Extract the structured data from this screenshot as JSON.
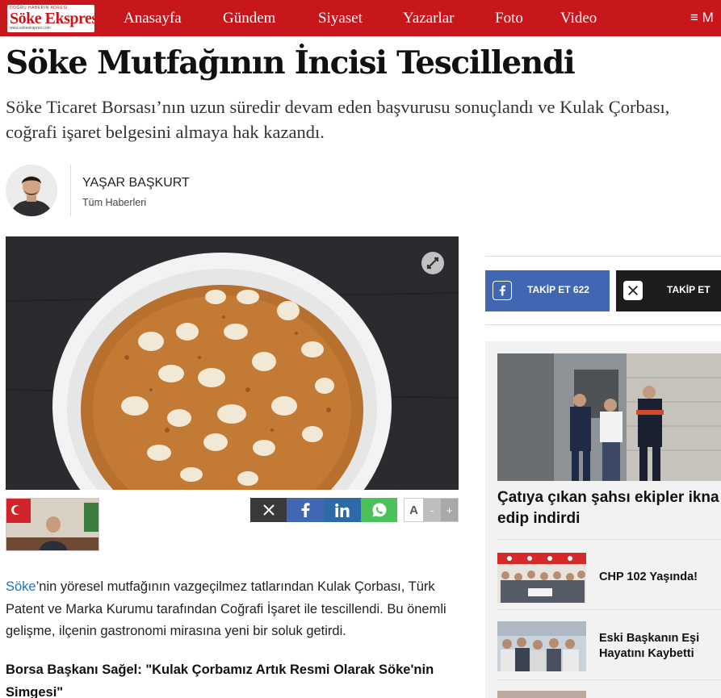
{
  "logo": {
    "tagline": "DOĞRU HABERIN ADRESI",
    "name": "Söke Ekspres",
    "subline": "www.sokeekspres.com"
  },
  "nav": {
    "items": [
      "Anasayfa",
      "Gündem",
      "Siyaset",
      "Yazarlar",
      "Foto",
      "Video"
    ],
    "menu_label": "≡ M"
  },
  "article": {
    "title": "Söke Mutfağının İncisi Tescillendi",
    "summary": "Söke Ticaret Borsası’nın uzun süredir devam eden başvurusu sonuçlandı ve Kulak Çorbası, coğrafi işaret belgesini almaya hak kazandı.",
    "author": {
      "name": "YAŞAR BAŞKURT",
      "all_news": "Tüm Haberleri"
    },
    "share": {
      "x_icon": "x-logo-icon",
      "facebook_icon": "facebook-icon",
      "linkedin_icon": "linkedin-icon",
      "whatsapp_icon": "whatsapp-icon"
    },
    "font_controls": {
      "letter": "A",
      "minus": "-",
      "plus": "+"
    },
    "paragraph1": {
      "link_text": "Söke",
      "rest": "’nin yöresel mutfağının vazgeçilmez tatlarından Kulak Çorbası, Türk Patent ve Marka Kurumu tarafından Coğrafi İşaret ile tescillendi. Bu önemli gelişme, ilçenin gastronomi mirasına yeni bir soluk getirdi."
    },
    "subheading": "Borsa Başkanı Sağel: \"Kulak Çorbamız Artık Resmi Olarak Söke'nin Simgesi\""
  },
  "sidebar": {
    "follow_facebook": "TAKİP ET 622",
    "follow_x": "TAKİP ET",
    "lead_news": "Çatıya çıkan şahsı ekipler ikna edip indirdi",
    "news": [
      "CHP 102 Yaşında!",
      "Eski Başkanın Eşi Hayatını Kaybetti"
    ]
  },
  "colors": {
    "brand_red": "#c8161d",
    "facebook_blue": "#4267b2",
    "linkedin_blue": "#2c6aa8",
    "whatsapp_green": "#4cc159",
    "link_blue": "#1a73c9"
  }
}
